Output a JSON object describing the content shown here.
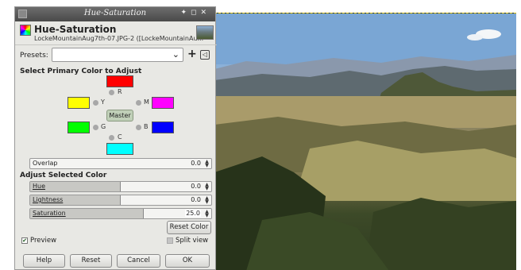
{
  "window": {
    "title": "Hue-Saturation"
  },
  "dialog": {
    "title": "Hue-Saturation",
    "subtitle": "LockeMountainAug7th-07.JPG-2 ([LockeMountainAu..."
  },
  "presets": {
    "label": "Presets:",
    "value": "",
    "add_symbol": "+",
    "menu_symbol": "◁"
  },
  "primary_colors": {
    "heading": "Select Primary Color to Adjust",
    "items": [
      {
        "key": "R",
        "color": "#ff0000"
      },
      {
        "key": "Y",
        "color": "#ffff00"
      },
      {
        "key": "M",
        "color": "#ff00ff"
      },
      {
        "key": "G",
        "color": "#00ff00"
      },
      {
        "key": "B",
        "color": "#0000ff"
      },
      {
        "key": "C",
        "color": "#00ffff"
      }
    ],
    "master_label": "Master"
  },
  "overlap": {
    "label": "Overlap",
    "value": "0.0",
    "fraction": 0
  },
  "adjust": {
    "heading": "Adjust Selected Color",
    "hue": {
      "label": "Hue",
      "value": "0.0",
      "fraction": 0.5
    },
    "lightness": {
      "label": "Lightness",
      "value": "0.0",
      "fraction": 0.5
    },
    "saturation": {
      "label": "Saturation",
      "value": "25.0",
      "fraction": 0.625
    },
    "reset_color_label": "Reset Color"
  },
  "options": {
    "preview_label": "Preview",
    "preview_checked": true,
    "split_view_label": "Split view",
    "split_view_checked": false
  },
  "buttons": {
    "help": "Help",
    "reset": "Reset",
    "cancel": "Cancel",
    "ok": "OK"
  }
}
